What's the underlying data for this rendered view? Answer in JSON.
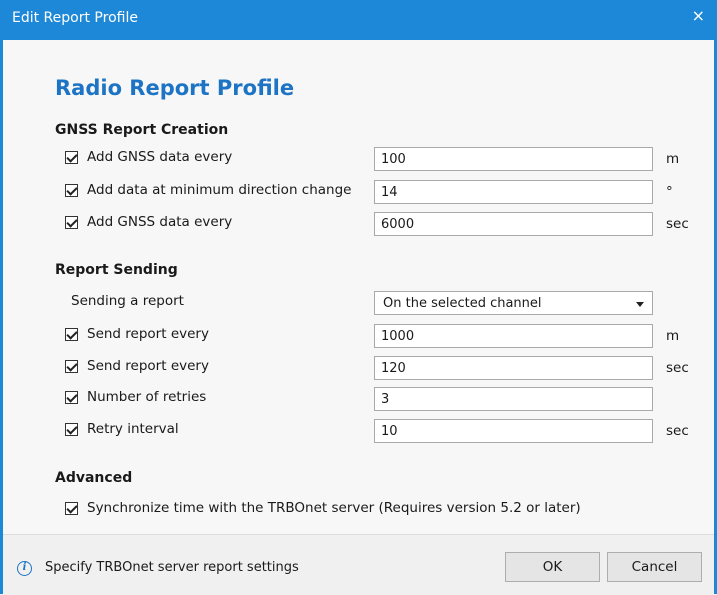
{
  "window": {
    "title": "Edit Report Profile",
    "close_glyph": "×"
  },
  "heading": "Radio Report Profile",
  "gnss": {
    "title": "GNSS Report Creation",
    "rows": [
      {
        "label": "Add GNSS data every",
        "value": "100",
        "unit": "m",
        "checked": true
      },
      {
        "label": "Add data at minimum direction change",
        "value": "14",
        "unit": "°",
        "checked": true
      },
      {
        "label": "Add GNSS data every",
        "value": "6000",
        "unit": "sec",
        "checked": true
      }
    ]
  },
  "sending": {
    "title": "Report Sending",
    "mode_label": "Sending a report",
    "mode_value": "On the selected channel",
    "rows": [
      {
        "label": "Send report every",
        "value": "1000",
        "unit": "m",
        "checked": true
      },
      {
        "label": "Send report every",
        "value": "120",
        "unit": "sec",
        "checked": true
      },
      {
        "label": "Number of retries",
        "value": "3",
        "unit": "",
        "checked": true
      },
      {
        "label": "Retry interval",
        "value": "10",
        "unit": "sec",
        "checked": true
      }
    ]
  },
  "advanced": {
    "title": "Advanced",
    "sync_label": "Synchronize time with the TRBOnet server (Requires version 5.2 or later)",
    "sync_checked": true
  },
  "footer": {
    "info_text": "Specify TRBOnet server report settings",
    "ok_label": "OK",
    "cancel_label": "Cancel"
  },
  "colors": {
    "accent": "#1e88d8",
    "heading": "#1e74c4"
  },
  "icons": {
    "info": "info-icon",
    "close": "close-icon",
    "dropdown": "chevron-down-icon",
    "check": "checkmark-icon"
  }
}
